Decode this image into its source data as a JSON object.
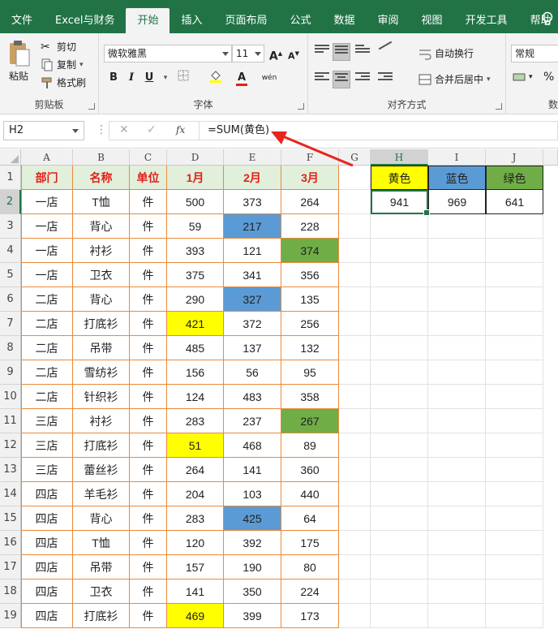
{
  "menu": {
    "tabs": [
      "文件",
      "Excel与财务",
      "开始",
      "插入",
      "页面布局",
      "公式",
      "数据",
      "审阅",
      "视图",
      "开发工具",
      "帮助"
    ],
    "active_tab": "开始"
  },
  "ribbon": {
    "clipboard": {
      "paste": "粘贴",
      "cut": "剪切",
      "copy": "复制",
      "format_painter": "格式刷",
      "label": "剪贴板"
    },
    "font": {
      "name": "微软雅黑",
      "size": "11",
      "label": "字体",
      "bold": "B",
      "italic": "I",
      "underline": "U",
      "grow": "A",
      "shrink": "A",
      "wen": "wén",
      "font_color_letter": "A"
    },
    "alignment": {
      "wrap": "自动换行",
      "merge": "合并后居中",
      "label": "对齐方式"
    },
    "number": {
      "format": "常规",
      "label": "数",
      "percent": "%"
    },
    "colors": {
      "accent": "#217346",
      "font_red": "#e0201a",
      "fill_yellow": "#ffff00"
    }
  },
  "formula_bar": {
    "name_box": "H2",
    "formula": "=SUM(黄色)",
    "fx": "fx"
  },
  "columns": [
    "A",
    "B",
    "C",
    "D",
    "E",
    "F",
    "G",
    "H",
    "I",
    "J"
  ],
  "rows": [
    "1",
    "2",
    "3",
    "4",
    "5",
    "6",
    "7",
    "8",
    "9",
    "10",
    "11",
    "12",
    "13",
    "14",
    "15",
    "16",
    "17",
    "18",
    "19"
  ],
  "table": {
    "headers": [
      "部门",
      "名称",
      "单位",
      "1月",
      "2月",
      "3月"
    ],
    "rows": [
      [
        "一店",
        "T恤",
        "件",
        "500",
        "373",
        "264"
      ],
      [
        "一店",
        "背心",
        "件",
        "59",
        "217",
        "228"
      ],
      [
        "一店",
        "衬衫",
        "件",
        "393",
        "121",
        "374"
      ],
      [
        "一店",
        "卫衣",
        "件",
        "375",
        "341",
        "356"
      ],
      [
        "二店",
        "背心",
        "件",
        "290",
        "327",
        "135"
      ],
      [
        "二店",
        "打底衫",
        "件",
        "421",
        "372",
        "256"
      ],
      [
        "二店",
        "吊带",
        "件",
        "485",
        "137",
        "132"
      ],
      [
        "二店",
        "雪纺衫",
        "件",
        "156",
        "56",
        "95"
      ],
      [
        "二店",
        "针织衫",
        "件",
        "124",
        "483",
        "358"
      ],
      [
        "三店",
        "衬衫",
        "件",
        "283",
        "237",
        "267"
      ],
      [
        "三店",
        "打底衫",
        "件",
        "51",
        "468",
        "89"
      ],
      [
        "三店",
        "蕾丝衫",
        "件",
        "264",
        "141",
        "360"
      ],
      [
        "四店",
        "羊毛衫",
        "件",
        "204",
        "103",
        "440"
      ],
      [
        "四店",
        "背心",
        "件",
        "283",
        "425",
        "64"
      ],
      [
        "四店",
        "T恤",
        "件",
        "120",
        "392",
        "175"
      ],
      [
        "四店",
        "吊带",
        "件",
        "157",
        "190",
        "80"
      ],
      [
        "四店",
        "卫衣",
        "件",
        "141",
        "350",
        "224"
      ],
      [
        "四店",
        "打底衫",
        "件",
        "469",
        "399",
        "173"
      ]
    ],
    "highlights": [
      {
        "row": 1,
        "col": 4,
        "color": "blue"
      },
      {
        "row": 2,
        "col": 5,
        "color": "green"
      },
      {
        "row": 4,
        "col": 4,
        "color": "blue"
      },
      {
        "row": 5,
        "col": 3,
        "color": "yellow"
      },
      {
        "row": 9,
        "col": 5,
        "color": "green"
      },
      {
        "row": 10,
        "col": 3,
        "color": "yellow"
      },
      {
        "row": 13,
        "col": 4,
        "color": "blue"
      },
      {
        "row": 17,
        "col": 3,
        "color": "yellow"
      }
    ],
    "highlight_colors": {
      "yellow": "#ffff00",
      "blue": "#5b9bd5",
      "green": "#70ad47"
    }
  },
  "summary": {
    "headers": [
      "黄色",
      "蓝色",
      "绿色"
    ],
    "values": [
      "941",
      "969",
      "641"
    ],
    "header_colors": [
      "#ffff00",
      "#5b9bd5",
      "#70ad47"
    ]
  }
}
